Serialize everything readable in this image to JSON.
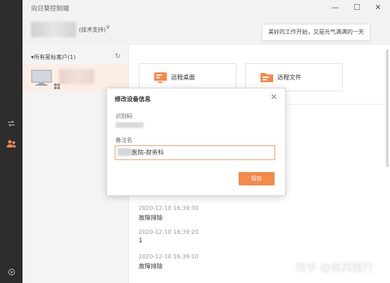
{
  "window": {
    "title": "向日葵控制端",
    "minimize": "—",
    "maximize": "☐",
    "close": "✕"
  },
  "header": {
    "user_tag": "(技术支持)",
    "chevron": "∨",
    "slogan": "美好的工作开始，又是元气满满的一天"
  },
  "sidebar": {
    "group_label": "▾所有星标客户(1)",
    "refresh": "↻"
  },
  "main": {
    "tiles": [
      {
        "label": "远程桌面"
      },
      {
        "label": "远程文件"
      }
    ],
    "logs": [
      {
        "time": "2020-12-10 16:39:30",
        "message": "故障排除"
      },
      {
        "time": "2020-12-10 16:39:20",
        "message": "1"
      },
      {
        "time": "2020-12-10 16:39:10",
        "message": "故障排除"
      }
    ]
  },
  "modal": {
    "title": "修改设备信息",
    "close": "✕",
    "id_label": "识别码",
    "note_label": "备注名",
    "note_value": "医院-财务科",
    "save_label": "保存"
  },
  "watermark": "知乎 @疾风随行",
  "colors": {
    "accent": "#f4894a",
    "rail": "#2c2c2c",
    "panel": "#f4f4f4",
    "selected_row": "#fdeee5"
  }
}
